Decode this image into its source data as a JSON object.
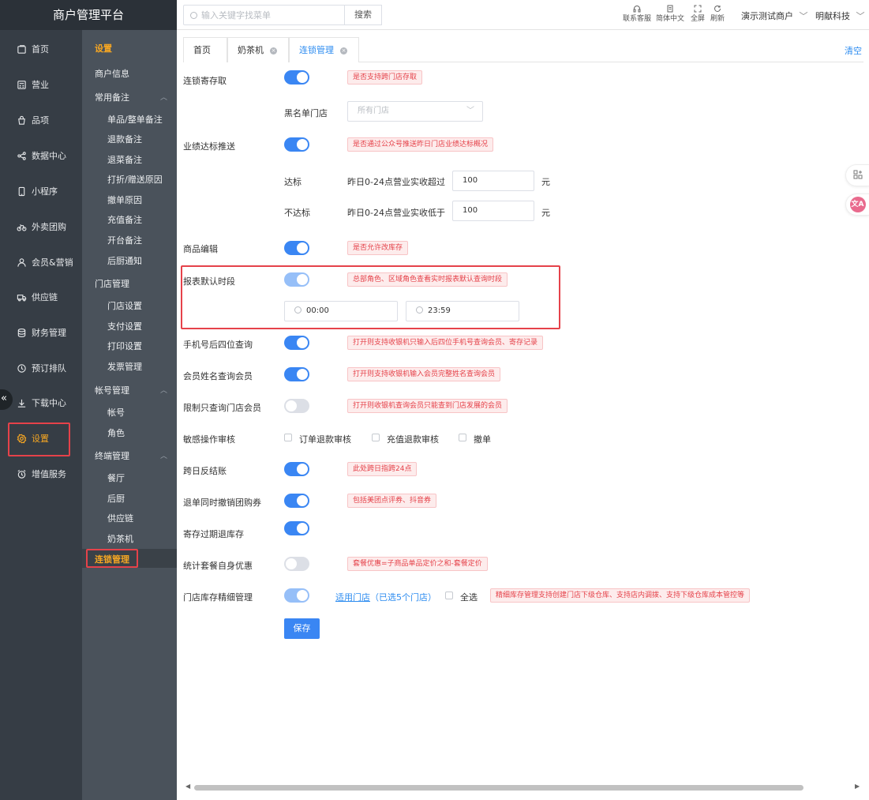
{
  "brand": "商户管理平台",
  "primary_nav": [
    {
      "label": "首页",
      "icon": "home-icon"
    },
    {
      "label": "营业",
      "icon": "calculator-icon"
    },
    {
      "label": "品项",
      "icon": "bag-icon"
    },
    {
      "label": "数据中心",
      "icon": "share-icon"
    },
    {
      "label": "小程序",
      "icon": "phone-icon"
    },
    {
      "label": "外卖团购",
      "icon": "bike-icon"
    },
    {
      "label": "会员&营销",
      "icon": "user-icon"
    },
    {
      "label": "供应链",
      "icon": "truck-icon"
    },
    {
      "label": "财务管理",
      "icon": "database-icon"
    },
    {
      "label": "预订排队",
      "icon": "clock-icon"
    },
    {
      "label": "下载中心",
      "icon": "download-icon"
    },
    {
      "label": "设置",
      "icon": "gear-icon"
    },
    {
      "label": "增值服务",
      "icon": "alarm-icon"
    }
  ],
  "secondary_nav": {
    "title": "设置",
    "merchant_info": "商户信息",
    "groups": [
      {
        "label": "常用备注",
        "items": [
          "单品/整单备注",
          "退款备注",
          "退菜备注",
          "打折/赠送原因",
          "撤单原因",
          "充值备注",
          "开台备注",
          "后厨通知"
        ]
      },
      {
        "label": "门店管理",
        "items": [
          "门店设置",
          "支付设置",
          "打印设置",
          "发票管理"
        ]
      },
      {
        "label": "帐号管理",
        "items": [
          "帐号",
          "角色"
        ]
      },
      {
        "label": "终端管理",
        "items": [
          "餐厅",
          "后厨",
          "供应链",
          "奶茶机"
        ]
      }
    ],
    "active": "连锁管理"
  },
  "topbar": {
    "search_placeholder": "输入关键字找菜单",
    "search_button": "搜索",
    "tools": [
      "联系客服",
      "简体中文",
      "全屏",
      "刷新"
    ],
    "merchant": "演示测试商户",
    "company": "明献科技"
  },
  "tabs": [
    {
      "label": "首页"
    },
    {
      "label": "奶茶机"
    },
    {
      "label": "连锁管理"
    }
  ],
  "clear_label": "清空",
  "form": {
    "chain_deposit": {
      "label": "连锁寄存取",
      "tip": "是否支持跨门店存取"
    },
    "blacklist": {
      "label": "黑名单门店",
      "placeholder": "所有门店"
    },
    "perf_push": {
      "label": "业绩达标推送",
      "tip": "是否通过公众号推送昨日门店业绩达标概况"
    },
    "reach": {
      "label": "达标",
      "desc": "昨日0-24点营业实收超过",
      "value": "100",
      "unit": "元"
    },
    "unreach": {
      "label": "不达标",
      "desc": "昨日0-24点营业实收低于",
      "value": "100",
      "unit": "元"
    },
    "item_edit": {
      "label": "商品编辑",
      "tip": "是否允许改库存"
    },
    "report_period": {
      "label": "报表默认时段",
      "tip": "总部角色、区域角色查看实时报表默认查询时段",
      "start": "00:00",
      "end": "23:59"
    },
    "phone_last4": {
      "label": "手机号后四位查询",
      "tip": "打开则支持收银机只输入后四位手机号查询会员、寄存记录"
    },
    "member_name": {
      "label": "会员姓名查询会员",
      "tip": "打开则支持收银机输入会员完整姓名查询会员"
    },
    "store_member_only": {
      "label": "限制只查询门店会员",
      "tip": "打开则收银机查询会员只能查到门店发展的会员"
    },
    "sensitive": {
      "label": "敏感操作审核",
      "options": [
        "订单退款审核",
        "充值退款审核",
        "撤单"
      ]
    },
    "cross_day": {
      "label": "跨日反结账",
      "tip": "此处跨日指跨24点"
    },
    "refund_cancel": {
      "label": "退单同时撤销团购券",
      "tip": "包括美团点评券、抖音券"
    },
    "expire_return": {
      "label": "寄存过期退库存"
    },
    "package_discount": {
      "label": "统计套餐自身优惠",
      "tip": "套餐优惠=子商品单品定价之和-套餐定价"
    },
    "inventory_fine": {
      "label": "门店库存精细管理",
      "link": "适用门店",
      "link_suffix": "（已选5个门店）",
      "select_all": "全选",
      "tip": "精细库存管理支持创建门店下级仓库、支持店内调拨、支持下级仓库成本管控等"
    },
    "save": "保存"
  }
}
